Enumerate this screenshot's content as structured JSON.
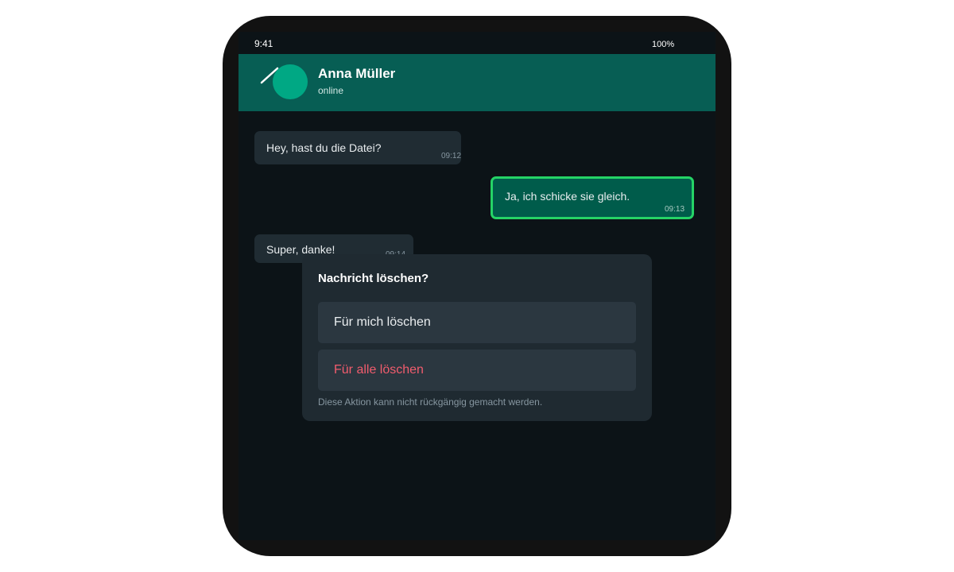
{
  "status_bar": {
    "time": "9:41",
    "battery": "100%"
  },
  "header": {
    "back_icon": "back-arrow-icon",
    "contact_name": "Anna Müller",
    "contact_status": "online",
    "color": "#075e54"
  },
  "messages": [
    {
      "direction": "incoming",
      "text": "Hey, hast du die Datei?",
      "time": "09:12",
      "selected": false
    },
    {
      "direction": "outgoing",
      "text": "Ja, ich schicke sie gleich.",
      "time": "09:13",
      "selected": true
    },
    {
      "direction": "incoming",
      "text": "Super, danke!",
      "time": "09:14",
      "selected": false
    }
  ],
  "delete_dialog": {
    "title": "Nachricht löschen?",
    "option_delete_for_me": "Für mich löschen",
    "option_delete_for_all": "Für alle löschen",
    "note": "Diese Aktion kann nicht rückgängig gemacht werden."
  },
  "colors": {
    "accent": "#25d366",
    "danger": "#f15c6d",
    "avatar": "#00a884"
  }
}
